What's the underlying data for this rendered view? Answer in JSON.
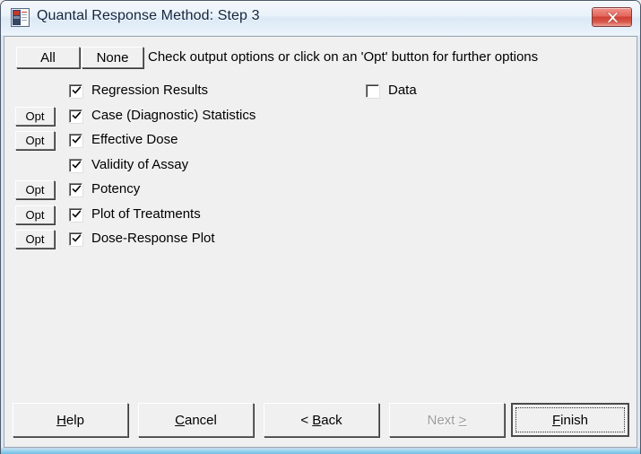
{
  "window": {
    "title": "Quantal Response Method: Step 3",
    "icon": "app-document-icon",
    "close_label": "x",
    "colors": {
      "titlebar_top": "#f4f8fc",
      "titlebar_bottom": "#eef5fb",
      "close_red": "#cf3f34",
      "client_bg": "#f0f0f0",
      "aero_glass": "#93cfeb",
      "frame_border": "#4b5a6b"
    }
  },
  "toolbar": {
    "all_label": "All",
    "none_label": "None",
    "instruction": "Check output options or click on an 'Opt' button for further options"
  },
  "options": {
    "opt_button_label": "Opt",
    "left_column": [
      {
        "label": "Regression Results",
        "checked": true,
        "has_opt": false
      },
      {
        "label": "Case (Diagnostic) Statistics",
        "checked": true,
        "has_opt": true
      },
      {
        "label": "Effective Dose",
        "checked": true,
        "has_opt": true
      },
      {
        "label": "Validity of Assay",
        "checked": true,
        "has_opt": false
      },
      {
        "label": "Potency",
        "checked": true,
        "has_opt": true
      },
      {
        "label": "Plot of Treatments",
        "checked": true,
        "has_opt": true
      },
      {
        "label": "Dose-Response Plot",
        "checked": true,
        "has_opt": true
      }
    ],
    "right_column": [
      {
        "label": "Data",
        "checked": false,
        "has_opt": false
      }
    ]
  },
  "footer": {
    "buttons": [
      {
        "label": "Help",
        "mnemonic": "H",
        "disabled": false,
        "default": false
      },
      {
        "label": "Cancel",
        "mnemonic": "C",
        "disabled": false,
        "default": false
      },
      {
        "label": "< Back",
        "mnemonic": "B",
        "disabled": false,
        "default": false
      },
      {
        "label": "Next >",
        "mnemonic": ">",
        "disabled": true,
        "default": false
      },
      {
        "label": "Finish",
        "mnemonic": "F",
        "disabled": false,
        "default": true
      }
    ]
  }
}
